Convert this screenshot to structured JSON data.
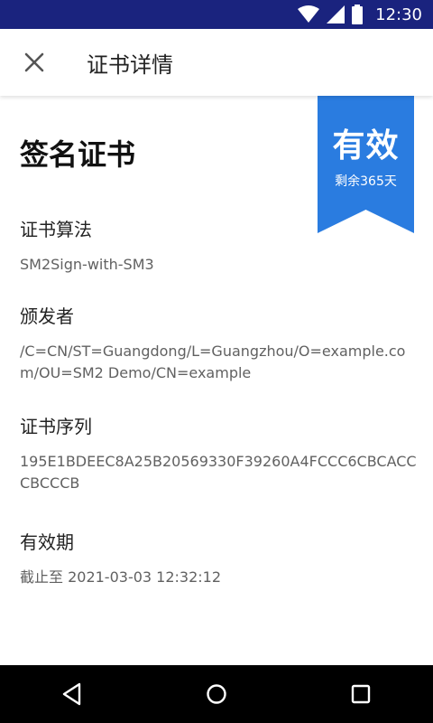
{
  "status_bar": {
    "time": "12:30"
  },
  "app_bar": {
    "title": "证书详情"
  },
  "certificate": {
    "title": "签名证书",
    "badge": {
      "status": "有效",
      "remaining": "剩余365天",
      "color": "#2a7ce0"
    },
    "fields": {
      "algorithm": {
        "label": "证书算法",
        "value": "SM2Sign-with-SM3"
      },
      "issuer": {
        "label": "颁发者",
        "value": "/C=CN/ST=Guangdong/L=Guangzhou/O=example.com/OU=SM2 Demo/CN=example"
      },
      "serial": {
        "label": "证书序列",
        "value": "195E1BDEEC8A25B20569330F39260A4FCCC6CBCACCCBCCCB"
      },
      "validity": {
        "label": "有效期",
        "value": "截止至 2021-03-03 12:32:12"
      }
    }
  },
  "icons": {
    "wifi": "wifi-icon",
    "signal": "signal-icon",
    "battery": "battery-icon",
    "close": "close-icon",
    "back": "back-icon",
    "home": "home-icon",
    "recents": "recents-icon"
  }
}
